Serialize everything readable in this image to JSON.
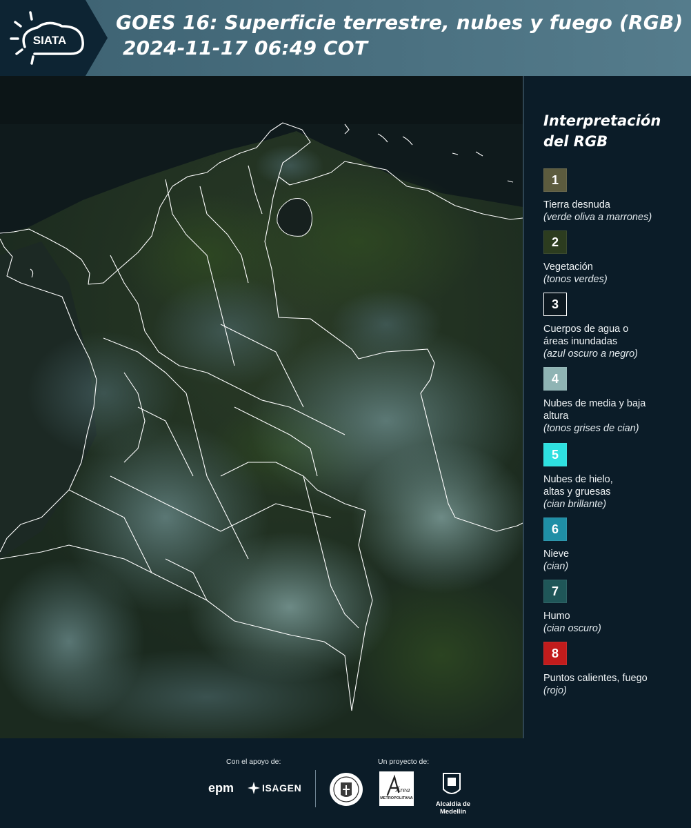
{
  "header": {
    "logo_text": "SIATA",
    "title_line1": "GOES 16: Superficie terrestre, nubes y fuego (RGB)",
    "title_line2": "2024-11-17 06:49 COT"
  },
  "legend": {
    "title": "Interpretación del RGB",
    "items": [
      {
        "number": "1",
        "label": "Tierra desnuda",
        "sub": "(verde oliva a marrones)",
        "color": "#5c5b3e"
      },
      {
        "number": "2",
        "label": "Vegetación",
        "sub": "(tonos verdes)",
        "color": "#2c3c1f"
      },
      {
        "number": "3",
        "label": "Cuerpos de agua o áreas inundadas",
        "sub": "(azul oscuro a negro)",
        "color": "#0c1820"
      },
      {
        "number": "4",
        "label": "Nubes de media y baja altura",
        "sub": "(tonos grises de cian)",
        "color": "#8fb4b4"
      },
      {
        "number": "5",
        "label": "Nubes de hielo, altas y gruesas",
        "sub": "(cian brillante)",
        "color": "#2ee0e0"
      },
      {
        "number": "6",
        "label": "Nieve",
        "sub": "(cian)",
        "color": "#1f8fa6"
      },
      {
        "number": "7",
        "label": "Humo",
        "sub": "(cian oscuro)",
        "color": "#1f5658"
      },
      {
        "number": "8",
        "label": "Puntos calientes, fuego",
        "sub": "(rojo)",
        "color": "#c21c1c"
      }
    ]
  },
  "footer": {
    "support_caption": "Con el apoyo de:",
    "project_caption": "Un proyecto de:",
    "sponsors": [
      "epm",
      "ISAGEN"
    ],
    "partners": [
      "Área Metropolitana Valle de Aburrá",
      "Alcaldía de Medellín"
    ],
    "epm_label": "epm",
    "isagen_label": "ISAGEN",
    "metro_label": "Área",
    "metro_sub": "METROPOLITANA",
    "alcaldia_label": "Alcaldía de Medellín"
  },
  "colors": {
    "header_left": "#0d2433",
    "header_right": "#4d7384",
    "background": "#0b1c28",
    "boundary": "#ffffff"
  }
}
